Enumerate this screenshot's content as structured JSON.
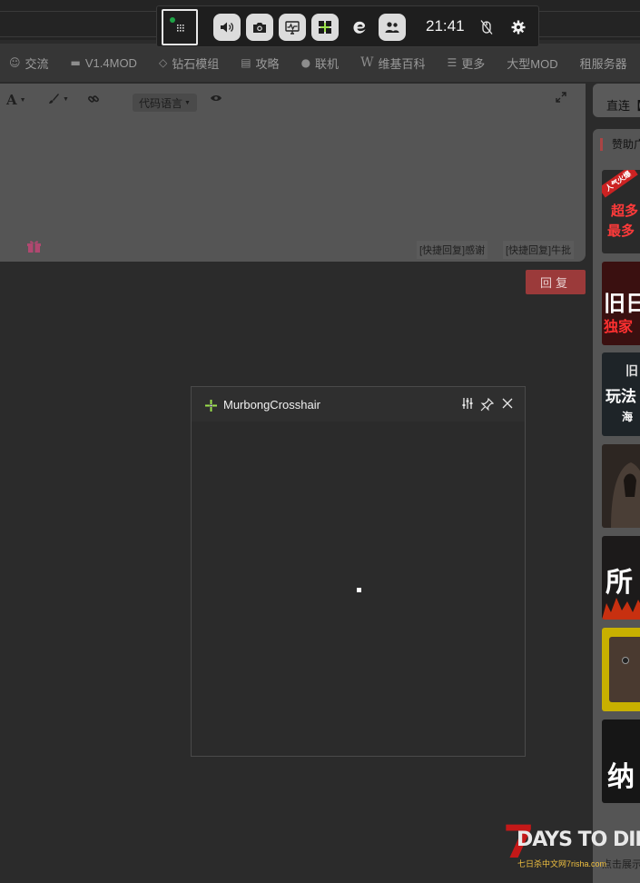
{
  "nav": {
    "items": [
      {
        "icon": "chat-bubbles-icon",
        "glyph": "☺",
        "label": "交流"
      },
      {
        "icon": "folder-icon",
        "glyph": "▬",
        "label": "V1.4MOD"
      },
      {
        "icon": "diamond-icon",
        "glyph": "◇",
        "label": "钻石模组"
      },
      {
        "icon": "book-icon",
        "glyph": "▤",
        "label": "攻略"
      },
      {
        "icon": "globe-icon",
        "glyph": "●",
        "label": "联机"
      },
      {
        "icon": "wikipedia-icon",
        "glyph": "W",
        "label": "维基百科"
      },
      {
        "icon": "list-icon",
        "glyph": "☰",
        "label": "更多"
      },
      {
        "icon": "",
        "glyph": "",
        "label": "大型MOD"
      },
      {
        "icon": "",
        "glyph": "",
        "label": "租服务器"
      }
    ]
  },
  "editor": {
    "font_button": "A",
    "code_language_label": "代码语言",
    "quick_reply_1": "[快捷回复]感谢",
    "quick_reply_2": "[快捷回复]牛批",
    "reply_button": "回复"
  },
  "sidebar": {
    "direct_label": "直连【",
    "sponsor_title": "赞助广",
    "ads": [
      {
        "text1": "超多",
        "text2": "最多",
        "bg": "#2a2a2a",
        "badge": "人气火爆"
      },
      {
        "text1": "旧日",
        "text2": "独家",
        "bg": "#3a1010"
      },
      {
        "text1": "旧",
        "text2": "玩法",
        "text3": "海",
        "bg": "#1e2428"
      },
      {
        "text1": "",
        "text2": "",
        "bg": "#2d2622"
      },
      {
        "text1": "所",
        "text2": "",
        "bg": "#1c1a1a"
      },
      {
        "text1": "",
        "text2": "",
        "bg": "#c8b000"
      },
      {
        "text1": "纳",
        "text2": "",
        "bg": "#161616"
      }
    ],
    "footer_text": "点击展示"
  },
  "overlay": {
    "title": "MurbongCrosshair"
  },
  "gamebar": {
    "time": "21:41"
  },
  "watermark": {
    "seven": "7",
    "title": "DAYS TO DIE",
    "subtitle": "七日杀中文网7risha.com"
  },
  "colors": {
    "reply_button": "#9b3a3a",
    "accent_red": "#c41818",
    "crosshair_green": "#9be14b"
  }
}
